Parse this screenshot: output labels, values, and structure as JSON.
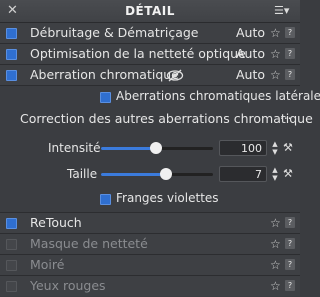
{
  "header": {
    "title": "DÉTAIL",
    "close_icon": "close-icon",
    "menu_icon": "menu-icon"
  },
  "tools": [
    {
      "label": "Débruitage & Dématriçage",
      "mode": "Auto",
      "enabled": true
    },
    {
      "label": "Optimisation de la netteté optique",
      "mode": "Auto",
      "enabled": true
    },
    {
      "label": "Aberration chromatique",
      "mode": "Auto",
      "enabled": true
    }
  ],
  "chromatic": {
    "lateral_label": "Aberrations chromatiques latérales",
    "lateral_checked": true,
    "other_label": "Correction des autres aberrations chromatique",
    "other_more": "...",
    "intensity": {
      "label": "Intensité",
      "value": "100",
      "fraction": 0.5
    },
    "size": {
      "label": "Taille",
      "value": "7",
      "fraction": 0.6
    },
    "purple_label": "Franges violettes",
    "purple_checked": true
  },
  "retouch": {
    "label": "ReTouch",
    "enabled": true
  },
  "disabled_tools": [
    {
      "label": "Masque de netteté"
    },
    {
      "label": "Moiré"
    },
    {
      "label": "Yeux rouges"
    }
  ],
  "help_label": "?",
  "colors": {
    "accent": "#3b7bdc",
    "background": "#3b3d41"
  }
}
